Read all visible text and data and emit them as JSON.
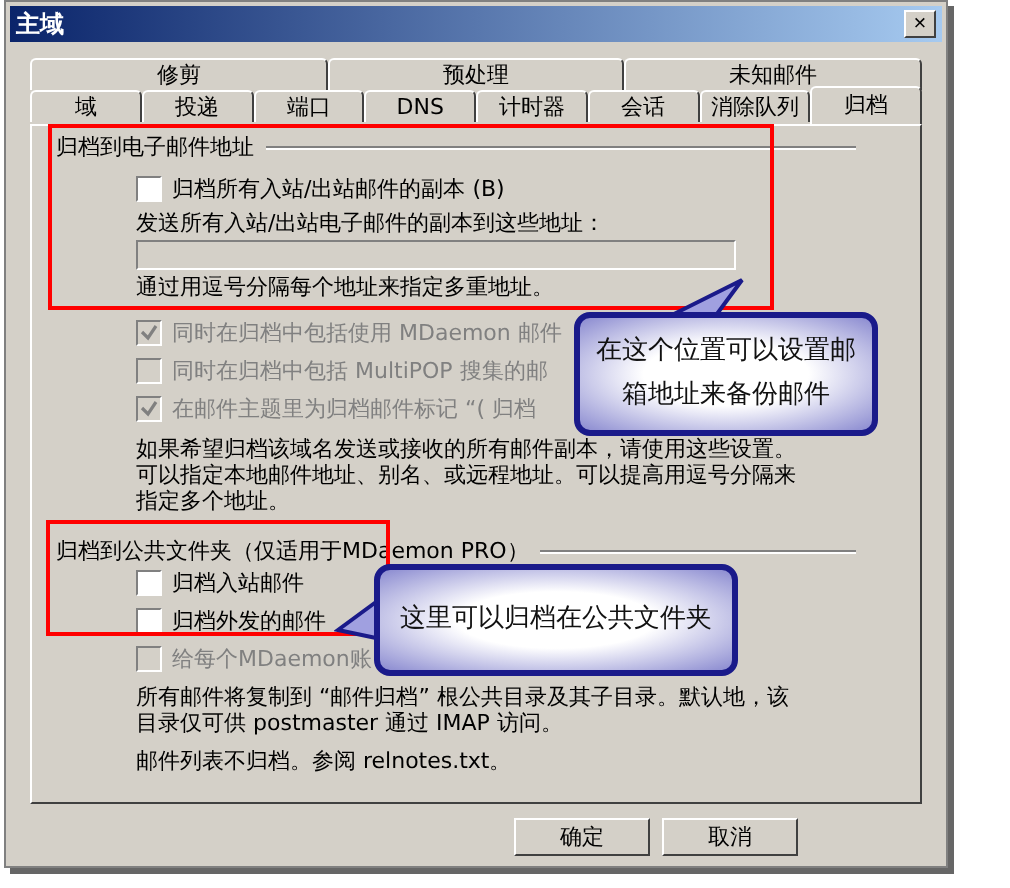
{
  "window": {
    "title": "主域",
    "close": "×"
  },
  "tabs": {
    "row_1": [
      {
        "label": "修剪",
        "selected": false
      },
      {
        "label": "预处理",
        "selected": false
      },
      {
        "label": "未知邮件",
        "selected": false
      }
    ],
    "row_2": [
      {
        "label": "域",
        "selected": false
      },
      {
        "label": "投递",
        "selected": false
      },
      {
        "label": "端口",
        "selected": false
      },
      {
        "label": "DNS",
        "selected": false
      },
      {
        "label": "计时器",
        "selected": false
      },
      {
        "label": "会话",
        "selected": false
      },
      {
        "label": "消除队列",
        "selected": false
      },
      {
        "label": "归档",
        "selected": true
      }
    ]
  },
  "email_section": {
    "title": "归档到电子邮件地址",
    "archive_checkbox": {
      "label": "归档所有入站/出站邮件的副本 (B)",
      "checked": false,
      "disabled": false
    },
    "address_label": "发送所有入站/出站电子邮件的副本到这些地址：",
    "address_hint": "通过用逗号分隔每个地址来指定多重地址。",
    "options": [
      {
        "label": "同时在归档中包括使用 MDaemon 邮件",
        "checked": true,
        "disabled": true
      },
      {
        "label": "同时在归档中包括 MultiPOP 搜集的邮",
        "checked": false,
        "disabled": true
      },
      {
        "label": "在邮件主题里为归档邮件标记 “( 归档",
        "checked": true,
        "disabled": true
      }
    ],
    "note": [
      "如果希望归档该域名发送或接收的所有邮件副本，请使用这些设置。",
      "可以指定本地邮件地址、别名、或远程地址。可以提高用逗号分隔来",
      "指定多个地址。"
    ]
  },
  "folder_section": {
    "title": "归档到公共文件夹（仅适用于MDaemon PRO）",
    "options": [
      {
        "label": "归档入站邮件",
        "checked": false,
        "disabled": false
      },
      {
        "label": "归档外发的邮件",
        "checked": false,
        "disabled": false
      },
      {
        "label": "给每个MDaemon账",
        "checked": false,
        "disabled": true
      }
    ],
    "note": [
      "所有邮件将复制到 “邮件归档” 根公共目录及其子目录。默认地，该",
      "目录仅可供 postmaster 通过 IMAP 访问。"
    ],
    "footer": "邮件列表不归档。参阅 relnotes.txt。"
  },
  "callouts": [
    {
      "text": [
        "在这个位置可以设置邮",
        "箱地址来备份邮件"
      ]
    },
    {
      "text": [
        "这里可以归档在公共文件夹"
      ]
    }
  ],
  "buttons": [
    {
      "label": "确定"
    },
    {
      "label": "取消"
    }
  ]
}
